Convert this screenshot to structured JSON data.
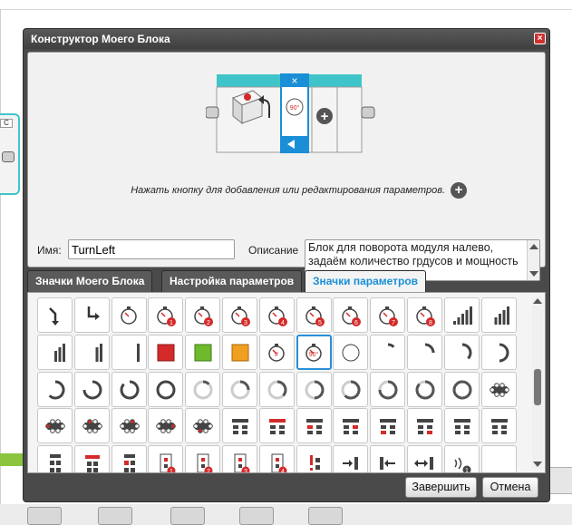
{
  "background": {
    "left_block_label": "C"
  },
  "dialog": {
    "title": "Конструктор Моего Блока",
    "close_symbol": "×",
    "hint": "Нажать кнопку для добавления или редактирования параметров.",
    "hint_plus_symbol": "+",
    "name_label": "Имя:",
    "name_value": "TurnLeft",
    "description_label": "Описание",
    "description_value": "Блок для поворота модуля налево, задаём количество грдусов и мощность",
    "block_preview": {
      "param_label": "90°",
      "close_symbol": "×",
      "add_symbol": "+"
    },
    "tabs": [
      {
        "label": "Значки Моего Блока",
        "active": false
      },
      {
        "label": "Настройка параметров",
        "active": false
      },
      {
        "label": "Значки параметров",
        "active": true
      }
    ],
    "buttons": {
      "finish": "Завершить",
      "cancel": "Отмена"
    },
    "colors": {
      "accent": "#1a8fd8",
      "teal": "#3fc5c9",
      "red": "#d42a2a",
      "green": "#6fba2c",
      "orange": "#f0a020"
    }
  },
  "icon_grid": [
    [
      "arrow-down-left-icon",
      "arrow-down-right-icon",
      "timer-icon",
      "timer-1-icon",
      "timer-2-icon",
      "timer-3-icon",
      "timer-4-icon",
      "timer-5-icon",
      "timer-6-icon",
      "timer-7-icon",
      "timer-8-icon",
      "signal-bars-5-icon",
      "signal-bars-4-icon"
    ],
    [
      "signal-bars-3-icon",
      "signal-bars-2-icon",
      "signal-bars-1-icon",
      "red-square-icon",
      "green-square-icon",
      "orange-square-icon",
      "timer-hash-icon",
      "timer-90-icon",
      "circle-empty-icon",
      "circle-1-8-icon",
      "circle-2-8-icon",
      "circle-3-8-icon",
      "circle-4-8-icon"
    ],
    [
      "circle-5-8-icon",
      "circle-6-8-icon",
      "circle-7-8-icon",
      "circle-full-icon",
      "dash-circle-1-icon",
      "dash-circle-2-icon",
      "dash-circle-3-icon",
      "dash-circle-4-icon",
      "dash-circle-5-icon",
      "dash-circle-6-icon",
      "dash-circle-7-icon",
      "dash-circle-full-icon",
      "port-array-icon"
    ],
    [
      "port-array-red-1-icon",
      "port-array-red-2-icon",
      "port-array-red-3-icon",
      "port-array-red-4-icon",
      "port-array-red-5-icon",
      "port-block-icon",
      "port-block-red-1-icon",
      "port-block-red-2-icon",
      "port-block-red-3-icon",
      "port-block-red-4-icon",
      "port-block-red-5-icon",
      "port-block-red-6-icon",
      "port-block-red-7-icon"
    ],
    [
      "port-tall-icon",
      "port-tall-red-icon",
      "port-tall-red-2-icon",
      "sensor-1-icon",
      "sensor-2-icon",
      "sensor-3-icon",
      "sensor-4-icon",
      "exclaim-port-icon",
      "arrow-port-right-icon",
      "arrow-port-left-icon",
      "double-arrow-port-icon",
      "wave-1-icon",
      "port-blank-icon"
    ]
  ]
}
